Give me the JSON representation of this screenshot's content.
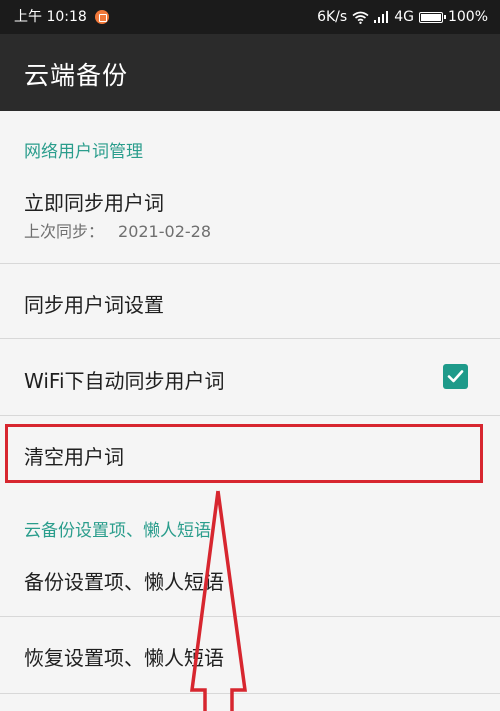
{
  "status_bar": {
    "time": "上午 10:18",
    "speed": "6K/s",
    "network": "4G",
    "battery": "100%",
    "icons": [
      "notification-icon",
      "wifi-icon",
      "signal-icon",
      "battery-icon"
    ]
  },
  "app_bar": {
    "title": "云端备份"
  },
  "sections": {
    "user_words": {
      "header": "网络用户词管理",
      "sync_now": {
        "title": "立即同步用户词",
        "subtitle_label": "上次同步：",
        "last_sync_date": "2021-02-28"
      },
      "sync_settings": {
        "title": "同步用户词设置"
      },
      "wifi_auto_sync": {
        "title": "WiFi下自动同步用户词",
        "checked": true
      },
      "clear_words": {
        "title": "清空用户词"
      }
    },
    "cloud_backup": {
      "header": "云备份设置项、懒人短语",
      "backup": {
        "title": "备份设置项、懒人短语"
      },
      "restore": {
        "title": "恢复设置项、懒人短语"
      }
    }
  },
  "colors": {
    "accent": "#2a9d8c",
    "checkbox": "#1e9a8a",
    "highlight": "#d7262f",
    "app_bar": "#2b2b2b",
    "status_bar": "#1b1b1b"
  }
}
